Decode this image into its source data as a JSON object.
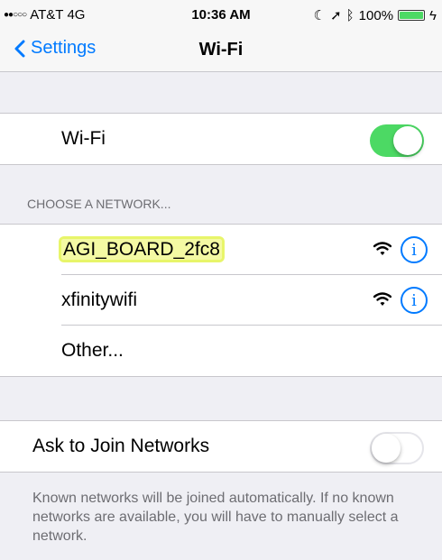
{
  "status": {
    "signal_dots": "●●○○○",
    "carrier": "AT&T",
    "network": "4G",
    "time": "10:36 AM",
    "battery": "100%"
  },
  "nav": {
    "back_label": "Settings",
    "title": "Wi-Fi"
  },
  "wifi": {
    "label": "Wi-Fi",
    "toggle_on": true
  },
  "networks": {
    "header": "CHOOSE A NETWORK...",
    "items": [
      {
        "name": "AGI_BOARD_2fc8",
        "info": "i"
      },
      {
        "name": "xfinitywifi",
        "info": "i"
      },
      {
        "name": "Other..."
      }
    ]
  },
  "ask": {
    "label": "Ask to Join Networks",
    "toggle_on": false
  },
  "footer": "Known networks will be joined automatically. If no known networks are available, you will have to manually select a network.",
  "colors": {
    "accent": "#007aff",
    "toggle_on": "#4cd964",
    "highlight": "#f4f9a3"
  }
}
